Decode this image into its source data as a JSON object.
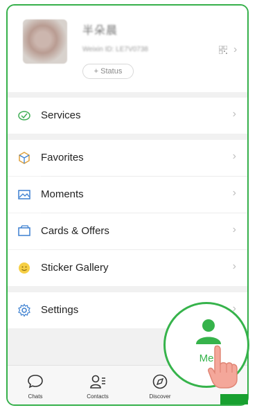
{
  "profile": {
    "name": "半朵晨",
    "wechat_id": "Weixin ID: LE7V0738",
    "status_label": "+ Status"
  },
  "menu": [
    {
      "label": "Services",
      "icon": "services-icon"
    },
    {
      "label": "Favorites",
      "icon": "favorites-cube-icon"
    },
    {
      "label": "Moments",
      "icon": "moments-picture-icon"
    },
    {
      "label": "Cards & Offers",
      "icon": "cards-wallet-icon"
    },
    {
      "label": "Sticker Gallery",
      "icon": "sticker-smile-icon"
    },
    {
      "label": "Settings",
      "icon": "settings-gear-icon"
    }
  ],
  "tabbar": {
    "tabs": [
      {
        "label": "Chats",
        "icon": "chat-bubble-icon"
      },
      {
        "label": "Contacts",
        "icon": "contacts-icon"
      },
      {
        "label": "Discover",
        "icon": "compass-icon"
      },
      {
        "label": "Me",
        "icon": "person-icon"
      }
    ]
  },
  "colors": {
    "accent_green": "#36b34b",
    "frame_border": "#35b04a"
  }
}
